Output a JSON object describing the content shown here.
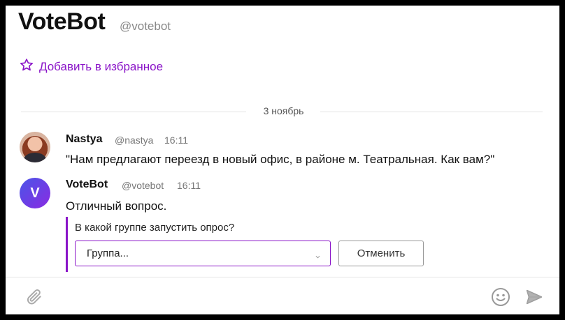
{
  "header": {
    "title": "VoteBot",
    "handle": "@votebot",
    "favorite_label": "Добавить в избранное"
  },
  "divider": {
    "date": "3 ноябрь"
  },
  "messages": [
    {
      "author": "Nastya",
      "handle": "@nastya",
      "time": "16:11",
      "text": "\"Нам предлагают переезд в новый офис, в районе м. Театральная. Как вам?\""
    },
    {
      "author": "VoteBot",
      "avatar_letter": "V",
      "handle": "@votebot",
      "time": "16:11",
      "text": "Отличный вопрос."
    }
  ],
  "poll": {
    "question": "В какой группе запустить опрос?",
    "select_placeholder": "Группа...",
    "cancel_label": "Отменить"
  },
  "colors": {
    "accent": "#8a14c8",
    "avatar_gradient_start": "#4a55e8",
    "avatar_gradient_end": "#8a2be2"
  },
  "icons": {
    "favorite": "star-outline-icon",
    "attach": "paperclip-icon",
    "emoji": "smiley-icon",
    "send": "paper-plane-icon",
    "select": "chevron-down-icon"
  }
}
